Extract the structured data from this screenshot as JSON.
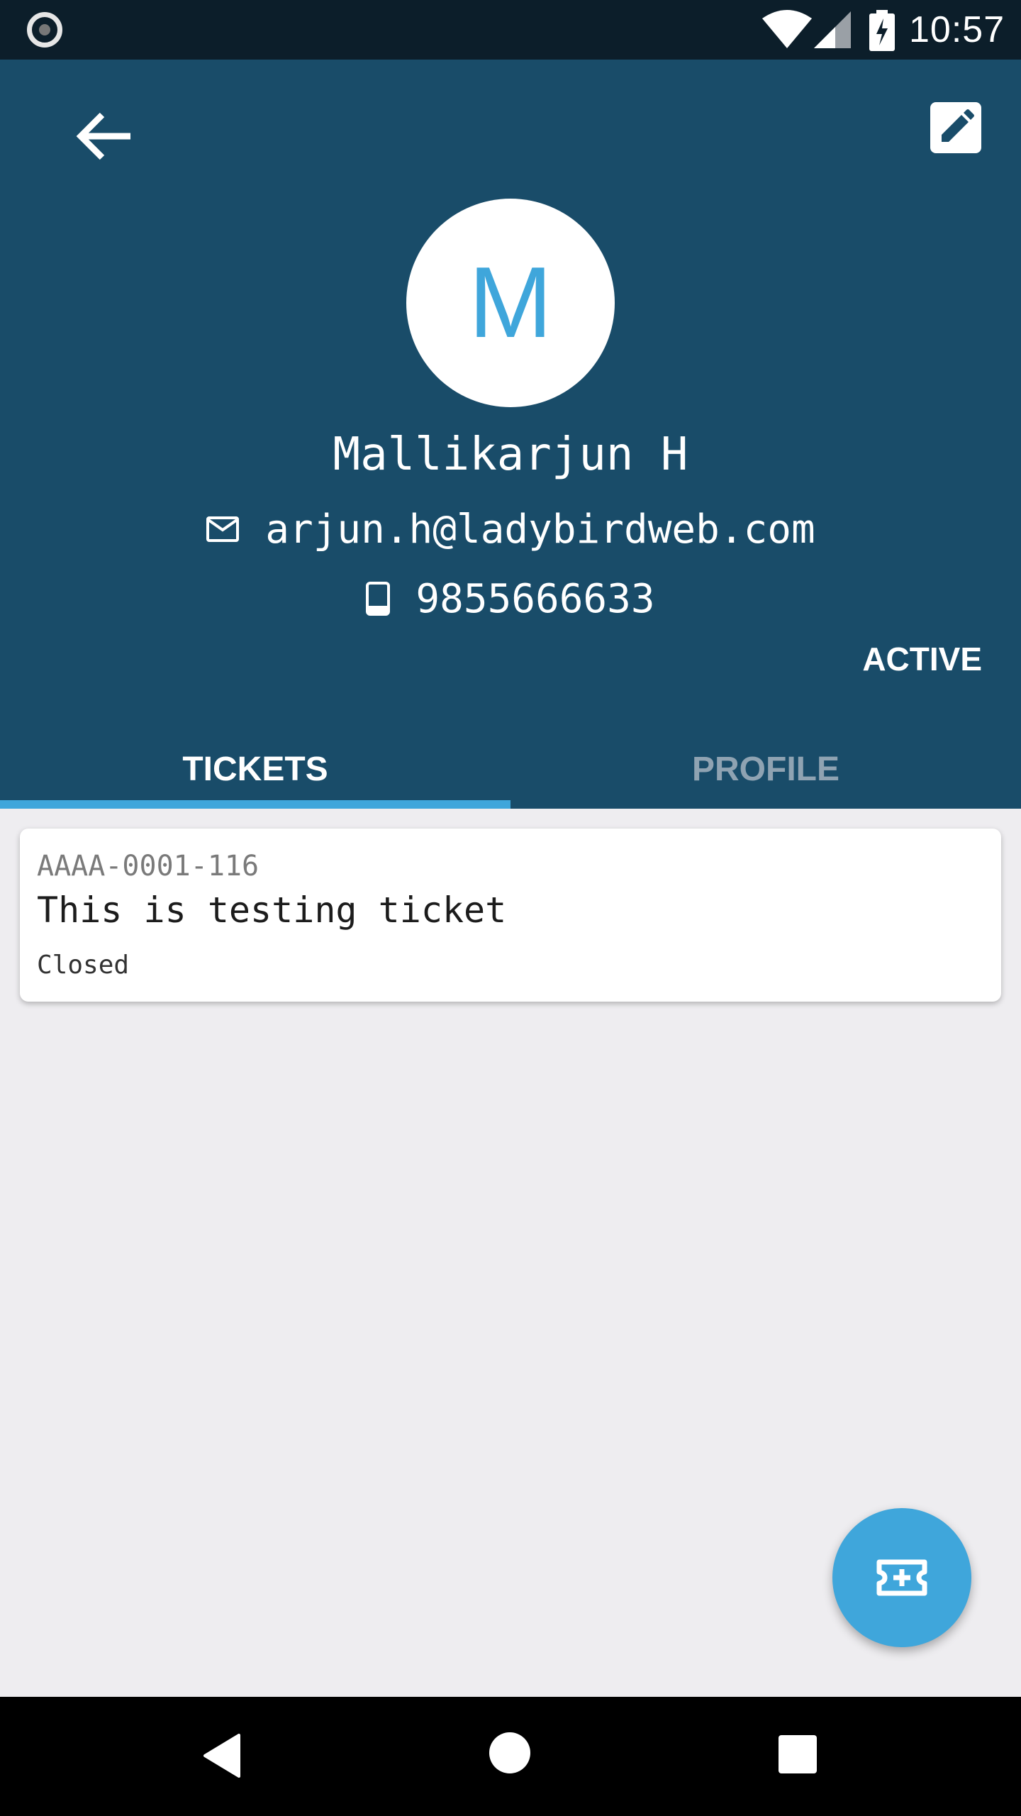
{
  "status_bar": {
    "time": "10:57"
  },
  "header": {
    "avatar_letter": "M",
    "name": "Mallikarjun H",
    "email": "arjun.h@ladybirdweb.com",
    "phone": "9855666633",
    "status": "ACTIVE"
  },
  "tabs": [
    {
      "label": "TICKETS",
      "selected": true
    },
    {
      "label": "PROFILE",
      "selected": false
    }
  ],
  "tickets": [
    {
      "id": "AAAA-0001-116",
      "title": "This is testing ticket",
      "status": "Closed"
    }
  ],
  "colors": {
    "header_bg": "#194c69",
    "accent": "#3fa6db",
    "page_bg": "#eeedf0"
  },
  "icons": {
    "back": "arrow-left-icon",
    "edit": "pencil-icon",
    "email": "mail-icon",
    "phone": "phone-icon",
    "fab": "ticket-add-icon"
  }
}
